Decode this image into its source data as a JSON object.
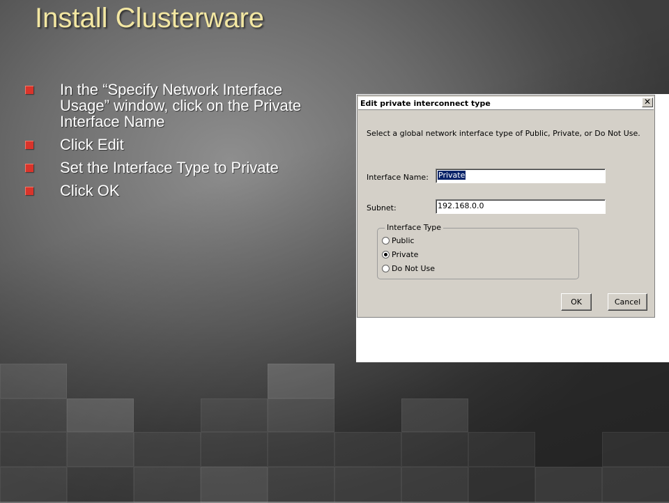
{
  "slide": {
    "title": "Install Clusterware",
    "bullets": [
      "In the “Specify Network Interface Usage” window, click on the Private Interface Name",
      "Click Edit",
      "Set the Interface Type to Private",
      "Click OK"
    ],
    "bullet_color": "#d9342b",
    "title_color": "#f3e7a2"
  },
  "dialog": {
    "title": "Edit private interconnect type",
    "close_glyph": "✕",
    "instruction": "Select a global network interface type of Public, Private, or Do Not Use.",
    "interface_name_label": "Interface Name:",
    "interface_name_value": "Private",
    "subnet_label": "Subnet:",
    "subnet_value": "192.168.0.0",
    "interface_type_group": "Interface Type",
    "radio_options": [
      "Public",
      "Private",
      "Do Not Use"
    ],
    "selected_option": "Private",
    "ok_label": "OK",
    "cancel_label": "Cancel"
  }
}
